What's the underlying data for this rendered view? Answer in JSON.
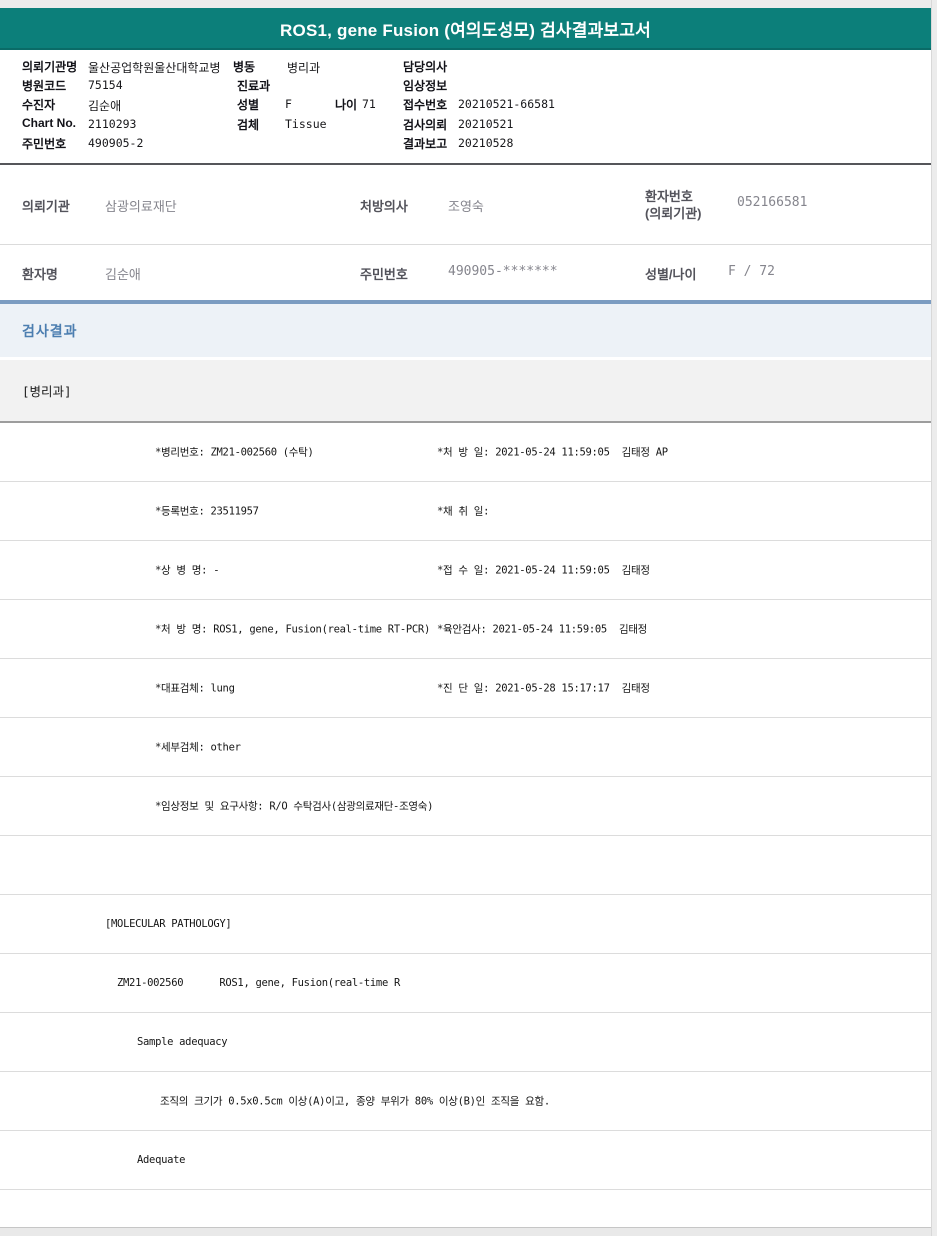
{
  "title": "ROS1, gene Fusion (여의도성모) 검사결과보고서",
  "patient_header": {
    "org": {
      "label": "의뢰기관명",
      "value": "울산공업학원울산대학교병"
    },
    "ward": {
      "label": "병동",
      "value": "병리과"
    },
    "attending": {
      "label": "담당의사",
      "value": ""
    },
    "hospital_code": {
      "label": "병원코드",
      "value": "75154"
    },
    "department": {
      "label": "진료과",
      "value": ""
    },
    "clinical_info": {
      "label": "임상정보",
      "value": ""
    },
    "patient": {
      "label": "수진자",
      "value": "김순애"
    },
    "sex": {
      "label": "성별",
      "value": "F"
    },
    "age": {
      "label": "나이",
      "value": "71"
    },
    "accession_no": {
      "label": "접수번호",
      "value": "20210521-66581"
    },
    "chart_no": {
      "label": "Chart No.",
      "value": "2110293"
    },
    "specimen": {
      "label": "검체",
      "value": "Tissue"
    },
    "request_date": {
      "label": "검사의뢰",
      "value": "20210521"
    },
    "resident_no": {
      "label": "주민번호",
      "value": "490905-2"
    },
    "report_date": {
      "label": "결과보고",
      "value": "20210528"
    }
  },
  "info_table": {
    "referrer": {
      "label": "의뢰기관",
      "value": "삼광의료재단"
    },
    "prescriber": {
      "label": "처방의사",
      "value": "조영숙"
    },
    "patient_no": {
      "label_line1": "환자번호",
      "label_line2": "(의뢰기관)",
      "value": "052166581"
    },
    "patient_name": {
      "label": "환자명",
      "value": "김순애"
    },
    "resident_no": {
      "label": "주민번호",
      "value": "490905-*******"
    },
    "sex_age": {
      "label": "성별/나이",
      "value": "F / 72"
    }
  },
  "results": {
    "section_title": "검사결과",
    "dept_header": "[병리과]",
    "rows": [
      {
        "left": "*병리번호: ZM21-002560 (수탁)",
        "right": "*처 방 일: 2021-05-24 11:59:05  김태정 AP"
      },
      {
        "left": "*등록번호: 23511957",
        "right": "*채 취 일:"
      },
      {
        "left": "*상 병 명: -",
        "right": "*접 수 일: 2021-05-24 11:59:05  김태정"
      },
      {
        "left": "*처 방 명: ROS1, gene, Fusion(real-time RT-PCR)",
        "right": "*육안검사: 2021-05-24 11:59:05  김태정"
      },
      {
        "left": "*대표검체: lung",
        "right": "*진 단 일: 2021-05-28 15:17:17  김태정"
      },
      {
        "left": "*세부검체: other",
        "right": ""
      },
      {
        "left": "*임상정보 및 요구사항: R/O 수탁검사(삼광의료재단-조영숙)",
        "right": ""
      },
      {
        "left": "",
        "right": ""
      },
      {
        "left": "[MOLECULAR PATHOLOGY]",
        "right": ""
      },
      {
        "left": "ZM21-002560      ROS1, gene, Fusion(real-time R",
        "right": ""
      },
      {
        "left": "Sample adequacy",
        "right": ""
      },
      {
        "left": "조직의 크기가 0.5x0.5cm 이상(A)이고, 종양 부위가 80% 이상(B)인 조직을 요함.",
        "right": ""
      },
      {
        "left": "Adequate",
        "right": ""
      },
      {
        "left": "",
        "right": ""
      }
    ]
  },
  "colors": {
    "title_bar": "#0C7F7A",
    "section_bar": "#7B9CC1",
    "section_bg": "#EDF2F7",
    "section_text": "#4C7EB0",
    "dept_band_bg": "#F2F2F2"
  }
}
